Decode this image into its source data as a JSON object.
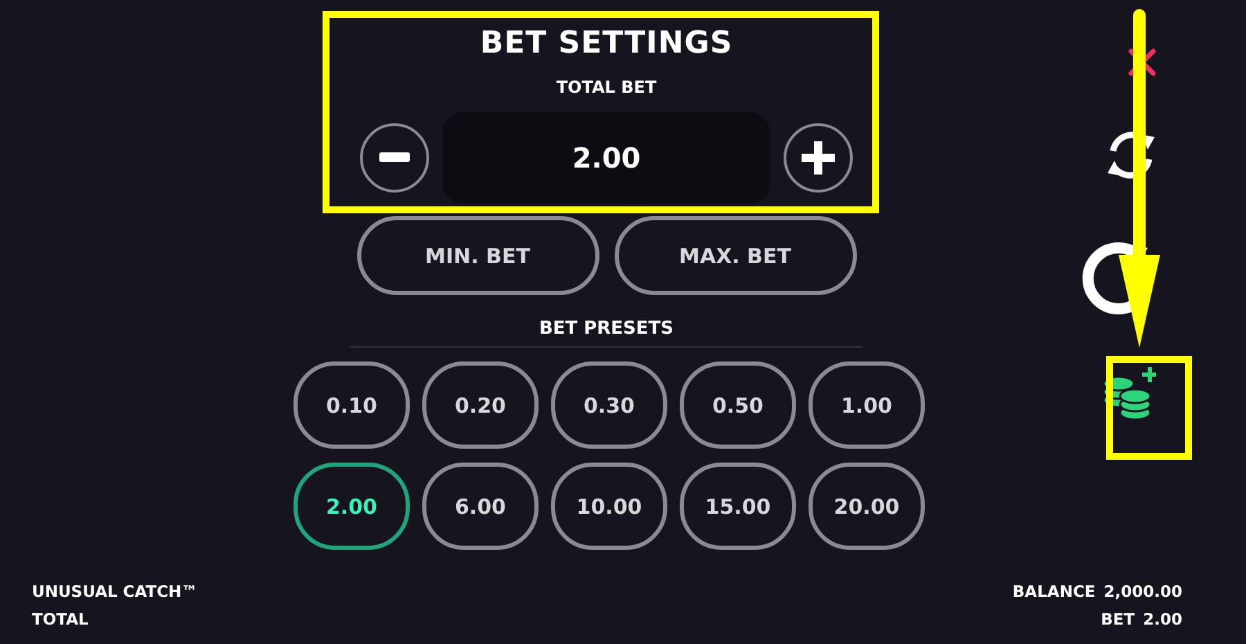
{
  "bet_settings": {
    "title": "BET SETTINGS",
    "total_bet_label": "TOTAL BET",
    "total_bet_value": "2.00"
  },
  "bet_buttons": [
    "MIN. BET",
    "MAX. BET"
  ],
  "bet_presets": {
    "title": "BET PRESETS",
    "items": [
      {
        "label": "0.10",
        "selected": false
      },
      {
        "label": "0.20",
        "selected": false
      },
      {
        "label": "0.30",
        "selected": false
      },
      {
        "label": "0.50",
        "selected": false
      },
      {
        "label": "1.00",
        "selected": false
      },
      {
        "label": "2.00",
        "selected": true
      },
      {
        "label": "6.00",
        "selected": false
      },
      {
        "label": "10.00",
        "selected": false
      },
      {
        "label": "15.00",
        "selected": false
      },
      {
        "label": "20.00",
        "selected": false
      }
    ]
  },
  "footer": {
    "game_title": "UNUSUAL CATCH™",
    "total_label": "TOTAL",
    "balance_label": "BALANCE",
    "balance_value": "2,000.00",
    "bet_label": "BET",
    "bet_value": "2.00"
  },
  "annotations": [
    {
      "kind": "frame"
    },
    {
      "kind": "arrow"
    },
    {
      "kind": "frame"
    }
  ]
}
